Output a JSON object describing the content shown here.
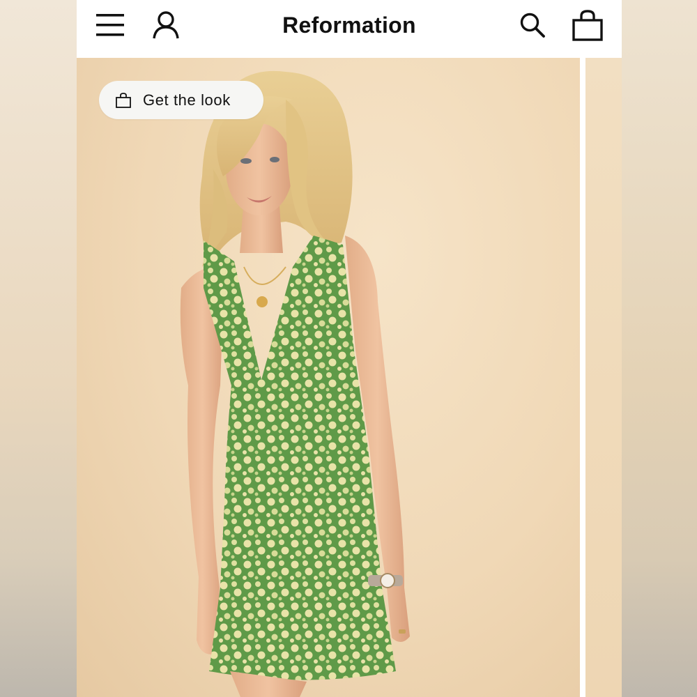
{
  "navbar": {
    "brand": "Reformation",
    "icons": {
      "menu": "hamburger-menu-icon",
      "account": "user-icon",
      "search": "search-icon",
      "bag": "shopping-bag-icon"
    }
  },
  "product_gallery": {
    "chip": {
      "label": "Get the look",
      "icon": "shopping-bag-icon"
    },
    "image": {
      "subject": "model wearing green floral mini dress"
    }
  },
  "colors": {
    "background_beige": "#f0d8b6",
    "dress_green": "#5f9a48",
    "flower_cream": "#e8e3a8",
    "chip_bg": "#f6f6f4",
    "text_dark": "#111111"
  }
}
